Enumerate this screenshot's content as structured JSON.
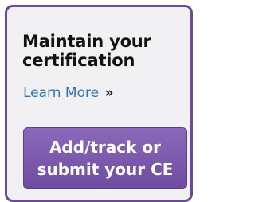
{
  "card": {
    "title": "Maintain your\ncertification",
    "learn_more_label": "Learn More",
    "learn_more_suffix": "»",
    "cta_label": "Add/track or\nsubmit your CE"
  },
  "colors": {
    "border": "#6b4a9c",
    "card_bg": "#f1f1f3",
    "link": "#2d73b4",
    "button_top": "#8a69ba",
    "button_bottom": "#6f4ba1"
  }
}
